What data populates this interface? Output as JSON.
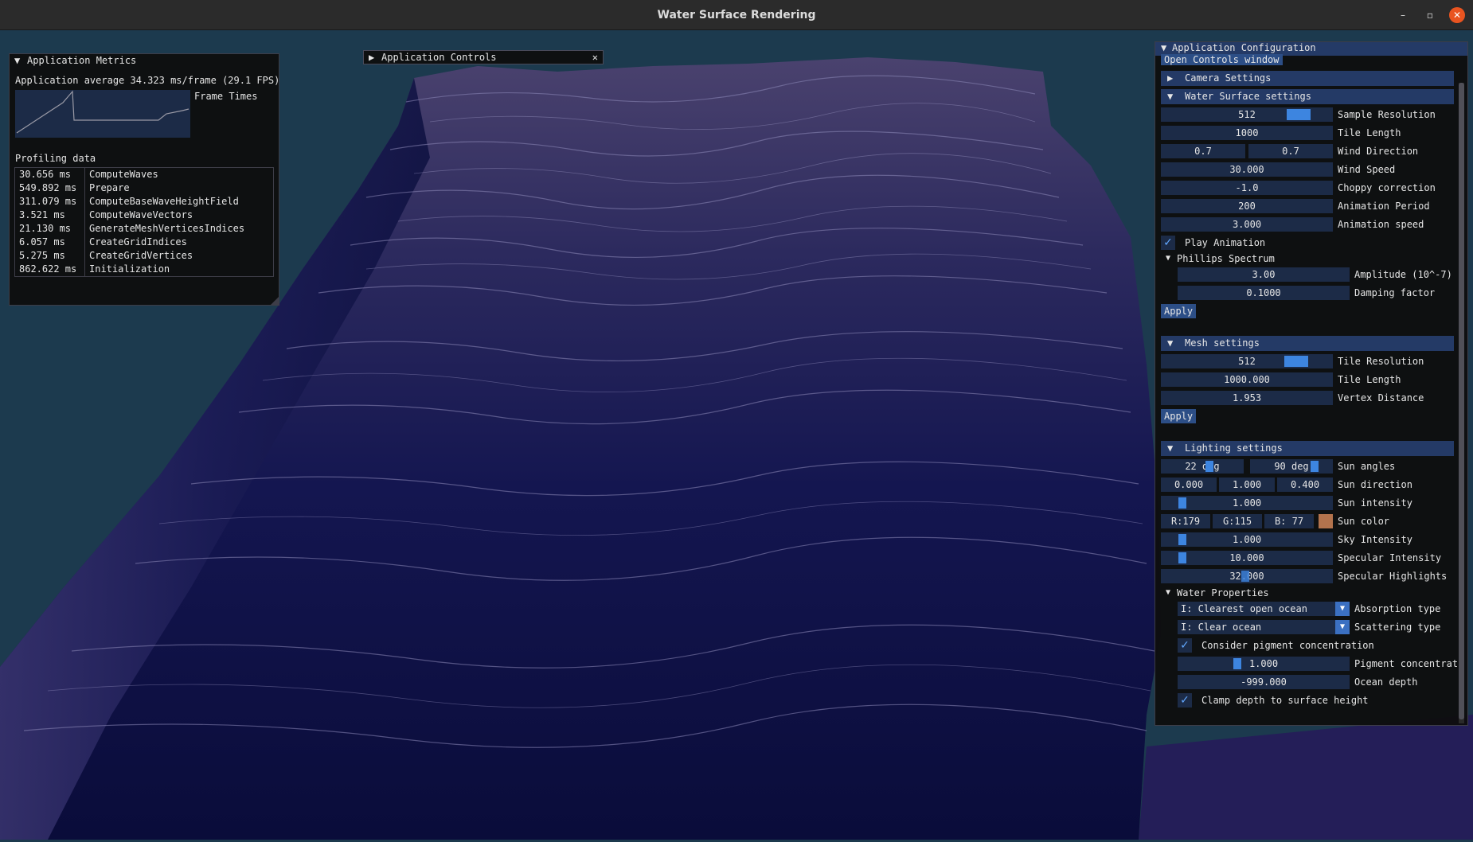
{
  "window": {
    "title": "Water Surface Rendering"
  },
  "colors": {
    "water_deep": "#0a0e3a",
    "water_crest": "#6d6a9a",
    "bg": "#1c3a4e",
    "accent": "#3d85e0",
    "field": "#1c2b47",
    "header": "#243a66",
    "close": "#e95420"
  },
  "metrics": {
    "title": "Application Metrics",
    "average": "Application average 34.323 ms/frame (29.1 FPS)",
    "frame_times_label": "Frame Times",
    "profiling_title": "Profiling data",
    "rows": [
      {
        "ms": "30.656 ms",
        "name": "ComputeWaves"
      },
      {
        "ms": "549.892 ms",
        "name": "Prepare"
      },
      {
        "ms": "311.079 ms",
        "name": "ComputeBaseWaveHeightField"
      },
      {
        "ms": "3.521 ms",
        "name": "ComputeWaveVectors"
      },
      {
        "ms": "21.130 ms",
        "name": "GenerateMeshVerticesIndices"
      },
      {
        "ms": "6.057 ms",
        "name": "CreateGridIndices"
      },
      {
        "ms": "5.275 ms",
        "name": "CreateGridVertices"
      },
      {
        "ms": "862.622 ms",
        "name": "Initialization"
      }
    ]
  },
  "controls": {
    "title": "Application Controls",
    "close": "✕"
  },
  "config": {
    "title": "Application Configuration",
    "open_controls": "Open Controls window",
    "camera": {
      "title": "Camera Settings"
    },
    "water": {
      "title": "Water Surface settings",
      "sample_resolution": {
        "value": "512",
        "label": "Sample Resolution"
      },
      "tile_length": {
        "value": "1000",
        "label": "Tile Length"
      },
      "wind_direction": {
        "x": "0.7",
        "y": "0.7",
        "label": "Wind Direction"
      },
      "wind_speed": {
        "value": "30.000",
        "label": "Wind Speed"
      },
      "choppy": {
        "value": "-1.0",
        "label": "Choppy correction"
      },
      "anim_period": {
        "value": "200",
        "label": "Animation Period"
      },
      "anim_speed": {
        "value": "3.000",
        "label": "Animation speed"
      },
      "play_animation": "Play Animation",
      "phillips": {
        "title": "Phillips Spectrum",
        "amplitude": {
          "value": "3.00",
          "label": "Amplitude (10^-7)"
        },
        "damping": {
          "value": "0.1000",
          "label": "Damping factor"
        }
      },
      "apply": "Apply"
    },
    "mesh": {
      "title": "Mesh settings",
      "tile_resolution": {
        "value": "512",
        "label": "Tile Resolution"
      },
      "tile_length": {
        "value": "1000.000",
        "label": "Tile Length"
      },
      "vertex_distance": {
        "value": "1.953",
        "label": "Vertex Distance"
      },
      "apply": "Apply"
    },
    "lighting": {
      "title": "Lighting settings",
      "sun_angles": {
        "a": "22 deg",
        "b": "90 deg",
        "label": "Sun angles"
      },
      "sun_direction": {
        "x": "0.000",
        "y": "1.000",
        "z": "0.400",
        "label": "Sun direction"
      },
      "sun_intensity": {
        "value": "1.000",
        "label": "Sun intensity"
      },
      "sun_color": {
        "r": "R:179",
        "g": "G:115",
        "b": "B: 77",
        "label": "Sun color",
        "swatch": "#b3734d"
      },
      "sky_intensity": {
        "value": "1.000",
        "label": "Sky Intensity"
      },
      "specular_intensity": {
        "value": "10.000",
        "label": "Specular Intensity"
      },
      "specular_highlights": {
        "value": "32.000",
        "label": "Specular Highlights"
      }
    },
    "water_props": {
      "title": "Water Properties",
      "absorption": {
        "value": "I: Clearest open ocean",
        "label": "Absorption type"
      },
      "scattering": {
        "value": "I: Clear ocean",
        "label": "Scattering type"
      },
      "consider_pigment": "Consider pigment concentration",
      "pigment": {
        "value": "1.000",
        "label": "Pigment concentrat"
      },
      "ocean_depth": {
        "value": "-999.000",
        "label": "Ocean depth"
      },
      "clamp_depth": "Clamp depth to surface height"
    }
  }
}
